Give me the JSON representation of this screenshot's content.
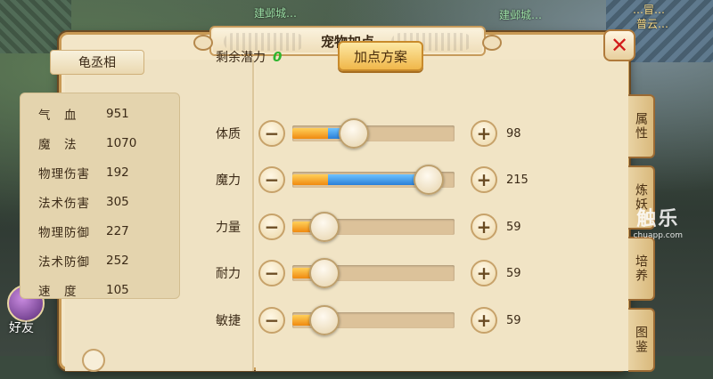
{
  "dialog": {
    "title": "宠物加点",
    "close_glyph": "✕"
  },
  "pet": {
    "name": "龟丞相"
  },
  "stats": [
    {
      "label": "气　血",
      "value": "951"
    },
    {
      "label": "魔　法",
      "value": "1070"
    },
    {
      "label": "物理伤害",
      "value": "192"
    },
    {
      "label": "法术伤害",
      "value": "305"
    },
    {
      "label": "物理防御",
      "value": "227"
    },
    {
      "label": "法术防御",
      "value": "252"
    },
    {
      "label": "速　度",
      "value": "105"
    }
  ],
  "potential": {
    "label": "剩余潜力",
    "value": "0"
  },
  "scheme_button": "加点方案",
  "attributes": [
    {
      "label": "体质",
      "value": "98",
      "base_fill": 0.22,
      "extra_fill": 0.13,
      "knob": 0.38
    },
    {
      "label": "魔力",
      "value": "215",
      "base_fill": 0.22,
      "extra_fill": 0.62,
      "knob": 0.84
    },
    {
      "label": "力量",
      "value": "59",
      "base_fill": 0.2,
      "extra_fill": 0.0,
      "knob": 0.2
    },
    {
      "label": "耐力",
      "value": "59",
      "base_fill": 0.2,
      "extra_fill": 0.0,
      "knob": 0.2
    },
    {
      "label": "敏捷",
      "value": "59",
      "base_fill": 0.2,
      "extra_fill": 0.0,
      "knob": 0.2
    }
  ],
  "buttons": {
    "minus": "−",
    "plus": "+"
  },
  "side_tabs": [
    "属性",
    "炼妖",
    "培养",
    "图鉴"
  ],
  "background": {
    "friend_label": "好友",
    "labels": [
      "建邺城…",
      "…冒…",
      "建邺城…",
      "普云…"
    ]
  },
  "watermark": {
    "big": "触乐",
    "small": "chuapp.com"
  },
  "colors": {
    "fill_orange": "#f08a10",
    "fill_blue": "#2a7fd8",
    "potential_green": "#2fb52f",
    "close_red": "#d21a1a"
  }
}
